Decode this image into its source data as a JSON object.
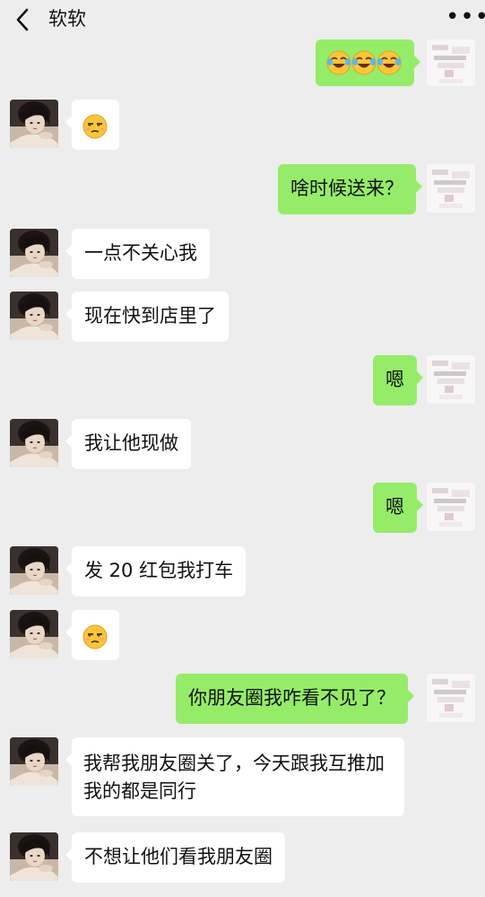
{
  "header": {
    "title": "软软",
    "back_icon": "chevron-left-icon",
    "more_icon": "more-dots-icon",
    "more_label": "•••"
  },
  "messages": [
    {
      "side": "right",
      "type": "emoji",
      "emojis": [
        "laugh-cry-emoji",
        "laugh-cry-emoji",
        "laugh-cry-emoji"
      ]
    },
    {
      "side": "left",
      "type": "emoji",
      "emojis": [
        "unamused-emoji"
      ]
    },
    {
      "side": "right",
      "text": "啥时候送来？"
    },
    {
      "side": "left",
      "text": "一点不关心我"
    },
    {
      "side": "left",
      "text": "现在快到店里了"
    },
    {
      "side": "right",
      "text": "嗯"
    },
    {
      "side": "left",
      "text": "我让他现做"
    },
    {
      "side": "right",
      "text": "嗯"
    },
    {
      "side": "left",
      "text": "发 20 红包我打车"
    },
    {
      "side": "left",
      "type": "emoji",
      "emojis": [
        "unamused-emoji"
      ]
    },
    {
      "side": "right",
      "text": "你朋友圈我咋看不见了？"
    },
    {
      "side": "left",
      "text": "我帮我朋友圈关了，今天跟我互推加我的都是同行"
    },
    {
      "side": "left",
      "text": "不想让他们看我朋友圈"
    }
  ],
  "colors": {
    "background": "#ededed",
    "bubble_self": "#95ec69",
    "bubble_other": "#ffffff"
  }
}
